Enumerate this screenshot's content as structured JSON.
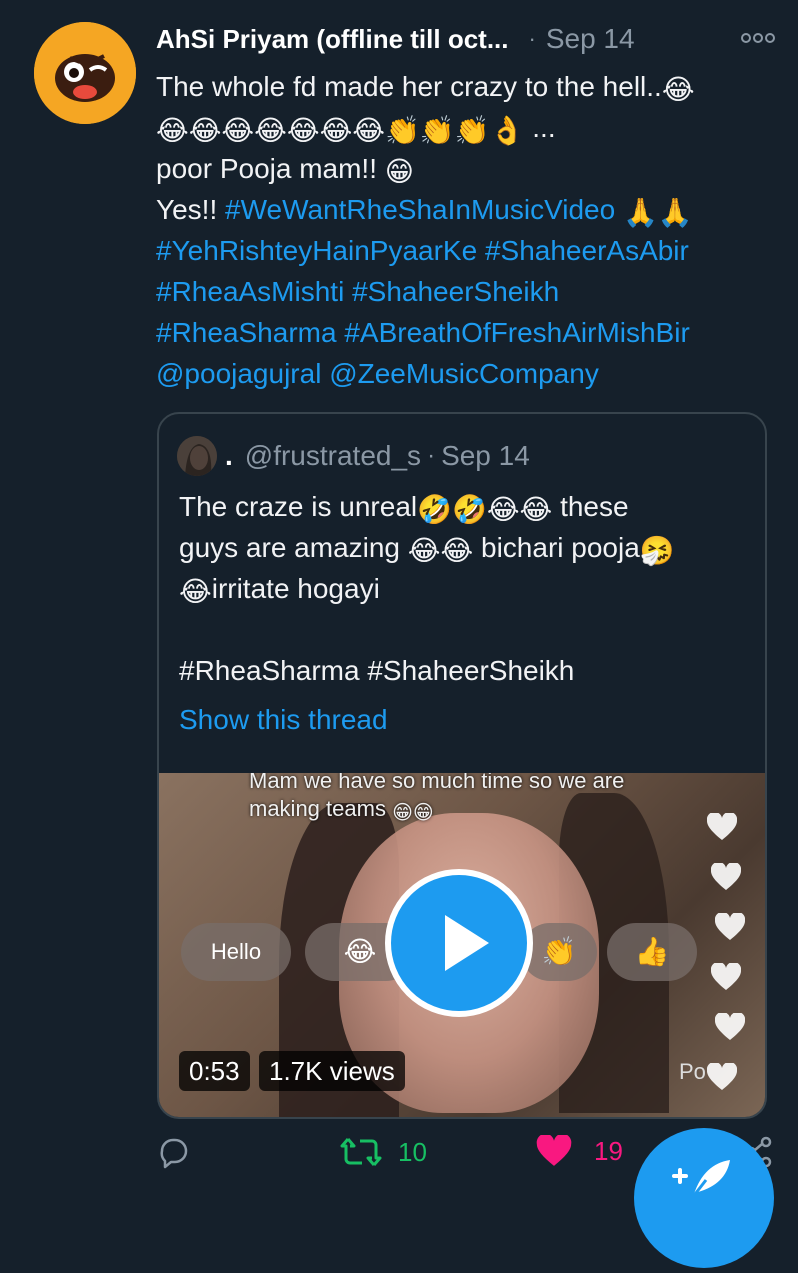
{
  "tweet": {
    "author_name": "AhSi Priyam (offline till oct...",
    "separator": "·",
    "date": "Sep 14",
    "lines": [
      "The whole fd made her crazy to the hell..",
      "...",
      "poor Pooja mam!!",
      "Yes!!",
      "#WeWantRheShaInMusicVideo",
      "#YehRishteyHainPyaarKe",
      "#ShaheerAsAbir",
      "#RheaAsMishti",
      "#ShaheerSheikh",
      "#RheaSharma",
      "#ABreathOfFreshAirMishBir",
      "@poojagujral",
      "@ZeeMusicCompany"
    ]
  },
  "quote": {
    "name": ".",
    "handle": "@frustrated_s",
    "separator": "·",
    "date": "Sep 14",
    "lines": [
      "The craze is unreal",
      "these",
      "guys are amazing",
      "bichari pooja",
      "irritate hogayi",
      "#RheaSharma #ShaheerSheikh"
    ],
    "show_thread": "Show this thread",
    "video": {
      "overlay_line1": "Mam we have so much time so we are",
      "overlay_line2": "making teams",
      "reaction_hello": "Hello",
      "corner_text": "Po",
      "duration": "0:53",
      "views": "1.7K views"
    }
  },
  "actions": {
    "retweets": "10",
    "likes": "19"
  },
  "colors": {
    "background": "#15202b",
    "link": "#1d9bf0",
    "retweet": "#17bf63",
    "like": "#f91880",
    "muted": "#8b98a5"
  }
}
